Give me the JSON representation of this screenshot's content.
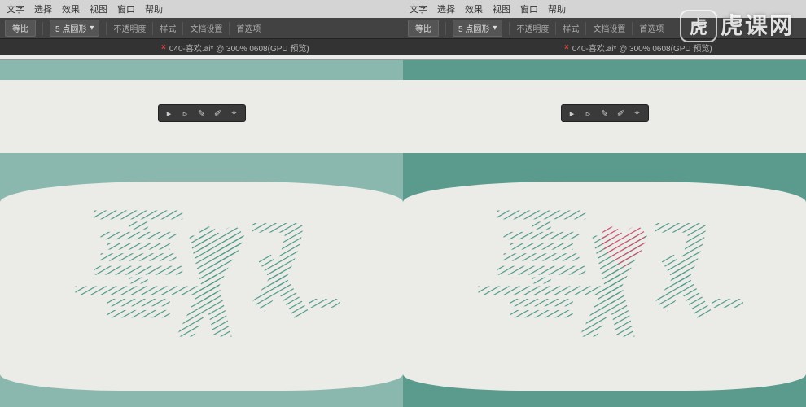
{
  "menus": {
    "items": [
      "文字",
      "选择",
      "效果",
      "视图",
      "窗口",
      "帮助"
    ]
  },
  "controlbar": {
    "btn1": "等比",
    "select1": "5 点圆形",
    "label1": "不透明度",
    "label2": "样式",
    "label3": "文档设置",
    "label4": "首选项"
  },
  "tab": {
    "close": "×",
    "left_title": "040-喜欢.ai* @ 300% 0608(GPU 预览)",
    "right_title": "040-喜欢.ai* @ 300% 0608(GPU 预览)"
  },
  "tools": {
    "t1": "▸",
    "t2": "▹",
    "t3": "✎",
    "t4": "✐",
    "t5": "⌖"
  },
  "watermark": {
    "badge": "虎",
    "text": "虎课网"
  },
  "colors": {
    "canvas": "#8bb8ae",
    "panel": "#ebece7",
    "stroke_teal": "#4d9688",
    "stroke_red": "#c94a6a"
  }
}
